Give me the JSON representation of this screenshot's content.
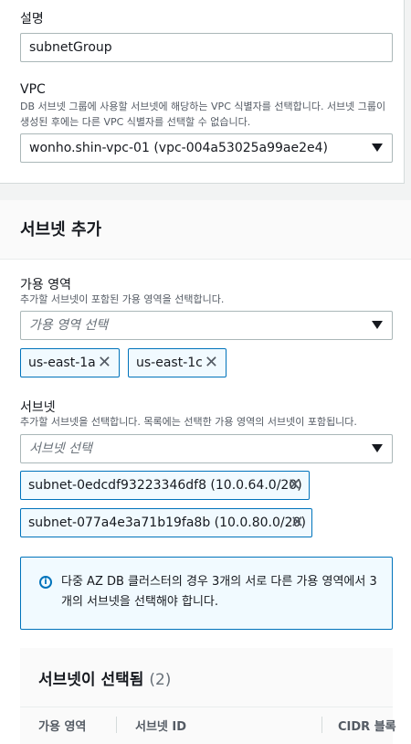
{
  "description_field": {
    "label": "설명",
    "value": "subnetGroup"
  },
  "vpc_field": {
    "label": "VPC",
    "description": "DB 서브넷 그룹에 사용할 서브넷에 해당하는 VPC 식별자를 선택합니다. 서브넷 그룹이 생성된 후에는 다른 VPC 식별자를 선택할 수 없습니다.",
    "selected": "wonho.shin-vpc-01 (vpc-004a53025a99ae2e4)"
  },
  "add_subnets": {
    "title": "서브넷 추가",
    "az_label": "가용 영역",
    "az_description": "추가할 서브넷이 포함된 가용 영역을 선택합니다.",
    "az_placeholder": "가용 영역 선택",
    "az_tokens": [
      "us-east-1a",
      "us-east-1c"
    ],
    "subnet_label": "서브넷",
    "subnet_description": "추가할 서브넷을 선택합니다. 목록에는 선택한 가용 영역의 서브넷이 포함됩니다.",
    "subnet_placeholder": "서브넷 선택",
    "subnet_tokens": [
      "subnet-0edcdf93223346df8 (10.0.64.0/20)",
      "subnet-077a4e3a71b19fa8b (10.0.80.0/20)"
    ],
    "alert_text": "다중 AZ DB 클러스터의 경우 3개의 서로 다른 가용 영역에서 3개의 서브넷을 선택해야 합니다.",
    "remove_glyph": "✕"
  },
  "selected_table": {
    "title": "서브넷이 선택됨",
    "count": "(2)",
    "columns": [
      "가용 영역",
      "서브넷 ID",
      "CIDR 블록"
    ]
  },
  "colors": {
    "accent": "#0073bb",
    "token_bg": "#f1faff",
    "page_bg": "#f2f3f3"
  },
  "icons": [
    "caret-down-icon",
    "close-icon",
    "info-icon"
  ]
}
